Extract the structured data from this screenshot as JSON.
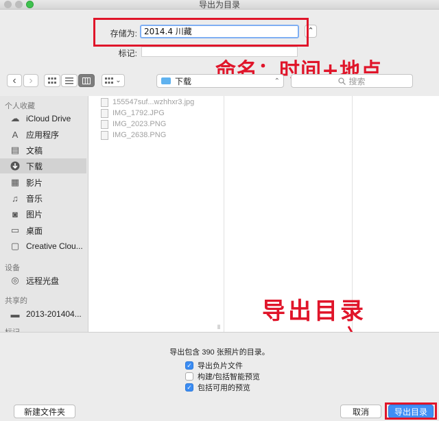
{
  "window": {
    "title": "导出为目录"
  },
  "save": {
    "label": "存储为:",
    "value": "2014.4 川藏",
    "tags_label": "标记:",
    "tags_value": "",
    "expand_glyph": "⌃"
  },
  "toolbar": {
    "back": "‹",
    "forward": "›",
    "location": "下载",
    "location_chevron": "⌃",
    "search_placeholder": "搜索",
    "group_chevron": "⌄"
  },
  "sidebar": {
    "favorites_header": "个人收藏",
    "favorites": [
      {
        "label": "iCloud Drive",
        "icon": "cloud-icon"
      },
      {
        "label": "应用程序",
        "icon": "apps-icon"
      },
      {
        "label": "文稿",
        "icon": "documents-icon"
      },
      {
        "label": "下载",
        "icon": "download-icon",
        "selected": true
      },
      {
        "label": "影片",
        "icon": "movies-icon"
      },
      {
        "label": "音乐",
        "icon": "music-icon"
      },
      {
        "label": "图片",
        "icon": "camera-icon"
      },
      {
        "label": "桌面",
        "icon": "desktop-icon"
      },
      {
        "label": "Creative Clou...",
        "icon": "folder-icon"
      }
    ],
    "devices_header": "设备",
    "devices": [
      {
        "label": "远程光盘",
        "icon": "disc-icon"
      }
    ],
    "shared_header": "共享的",
    "shared": [
      {
        "label": "2013-201404...",
        "icon": "computer-icon"
      }
    ],
    "tags_header": "标记"
  },
  "files": [
    {
      "name": "155547suf...wzhhxr3.jpg"
    },
    {
      "name": "IMG_1792.JPG"
    },
    {
      "name": "IMG_2023.PNG"
    },
    {
      "name": "IMG_2638.PNG"
    }
  ],
  "scroll_handle": "ll",
  "options": {
    "info": "导出包含 390 张照片的目录。",
    "checkboxes": [
      {
        "label": "导出负片文件",
        "checked": true
      },
      {
        "label": "构建/包括智能预览",
        "checked": false
      },
      {
        "label": "包括可用的预览",
        "checked": true
      }
    ]
  },
  "buttons": {
    "new_folder": "新建文件夹",
    "cancel": "取消",
    "export": "导出目录"
  },
  "annotations": {
    "naming": "命名：时间+地点",
    "export": "导出目录"
  },
  "colors": {
    "accent": "#3f8ef5",
    "annotation": "#e0152a"
  }
}
